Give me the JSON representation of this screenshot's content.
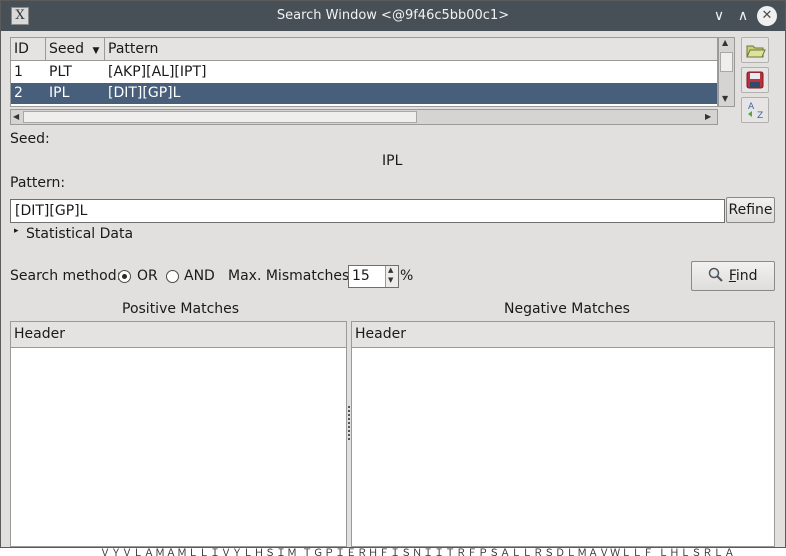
{
  "window": {
    "title": "Search Window <@9f46c5bb00c1>",
    "app_icon_glyph": "X",
    "min_glyph": "∨",
    "max_glyph": "∧",
    "close_glyph": "✕"
  },
  "seed_table": {
    "columns": [
      "ID",
      "Seed",
      "Pattern"
    ],
    "sort_indicator": "▼",
    "rows": [
      {
        "id": "1",
        "seed": "PLT",
        "pattern": "[AKP][AL][IPT]",
        "selected": false
      },
      {
        "id": "2",
        "seed": "IPL",
        "pattern": "[DIT][GP]L",
        "selected": true
      }
    ]
  },
  "side_buttons": [
    "open-folder-icon",
    "save-icon",
    "sort-az-icon"
  ],
  "seed": {
    "label": "Seed:",
    "value": "IPL"
  },
  "pattern": {
    "label": "Pattern:",
    "value": "[DIT][GP]L",
    "refine_label": "Refine"
  },
  "statistical": {
    "label": "Statistical Data",
    "expand_glyph": "▸"
  },
  "search": {
    "method_label": "Search method:",
    "or_label": "OR",
    "and_label": "AND",
    "selected": "OR",
    "mismatch_label": "Max. Mismatches:",
    "mismatch_value": "15",
    "percent": "%",
    "find_label": "Find",
    "find_mnemonic": "F"
  },
  "matches": {
    "positive_title": "Positive Matches",
    "negative_title": "Negative Matches",
    "positive_header": "Header",
    "negative_header": "Header"
  },
  "background_text": "ＶＹＶＬＡＭＡＭＬＬＩＶＹＬＨＳＩＭ ＴＧＰＩＥＲＨＦＩＳＮＩＩＴＲＦＰＳＡＬＬＲＳＤＬＭＡＶＷＬＬＦ ＬＨＬＳＲＬＡ"
}
